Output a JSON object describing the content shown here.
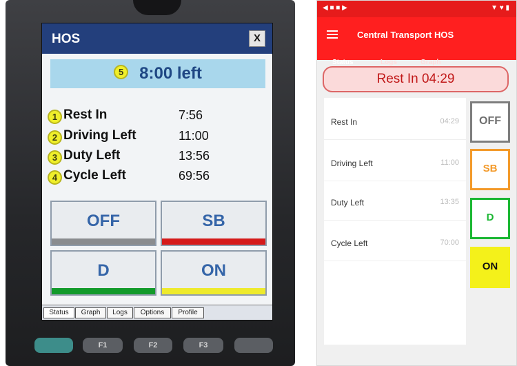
{
  "left_device": {
    "title": "HOS",
    "close_label": "X",
    "banner": {
      "number": "5",
      "text": "8:00 left"
    },
    "rows": [
      {
        "number": "1",
        "label": "Rest In",
        "value": "7:56"
      },
      {
        "number": "2",
        "label": "Driving Left",
        "value": "11:00"
      },
      {
        "number": "3",
        "label": "Duty Left",
        "value": "13:56"
      },
      {
        "number": "4",
        "label": "Cycle Left",
        "value": "69:56"
      }
    ],
    "buttons": [
      {
        "label": "OFF",
        "bar_color": "#8a8c8f"
      },
      {
        "label": "SB",
        "bar_color": "#d51a1a"
      },
      {
        "label": "D",
        "bar_color": "#129a2a"
      },
      {
        "label": "ON",
        "bar_color": "#eeea2c"
      }
    ],
    "tabs": [
      "Status",
      "Graph",
      "Logs",
      "Options",
      "Profile"
    ],
    "hardware_keys": [
      "",
      "F1",
      "F2",
      "F3",
      ""
    ]
  },
  "right_device": {
    "app_title": "Central Transport HOS",
    "tabs": [
      "Status",
      "Logs",
      "Graph"
    ],
    "banner": "Rest In 04:29",
    "list": [
      {
        "label": "Rest In",
        "value": "04:29"
      },
      {
        "label": "Driving Left",
        "value": "11:00"
      },
      {
        "label": "Duty Left",
        "value": "13:35"
      },
      {
        "label": "Cycle Left",
        "value": "70:00"
      }
    ],
    "buttons": [
      {
        "label": "OFF",
        "border_color": "#7d7d7d",
        "text_color": "#6f6f6f",
        "bg": "#ffffff"
      },
      {
        "label": "SB",
        "border_color": "#f39a2a",
        "text_color": "#f39a2a",
        "bg": "#ffffff"
      },
      {
        "label": "D",
        "border_color": "#1bb733",
        "text_color": "#1bb733",
        "bg": "#ffffff"
      },
      {
        "label": "ON",
        "border_color": "#f4f11a",
        "text_color": "#111111",
        "bg": "#f4f11a"
      }
    ]
  },
  "colors": {
    "left_title_bar": "#233f7c",
    "left_banner": "#a9d7ec",
    "right_app_bar": "#ff1f1f",
    "right_banner_text": "#c11919"
  }
}
